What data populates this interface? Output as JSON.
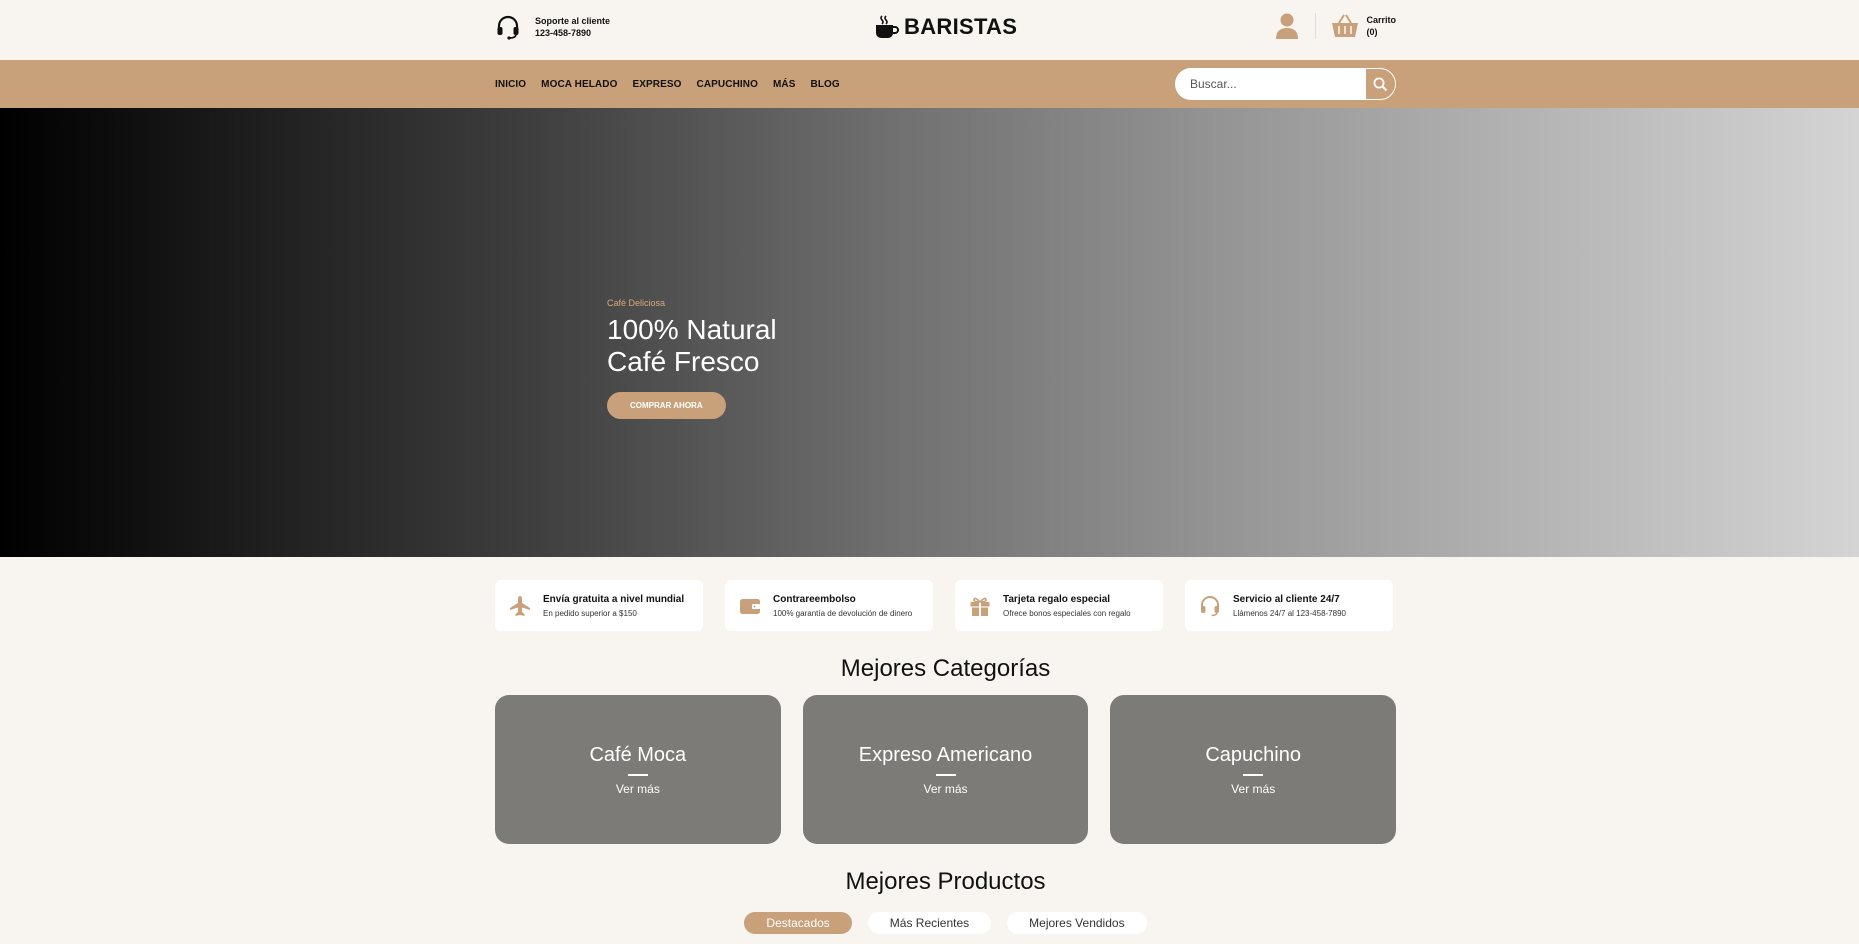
{
  "header": {
    "support_label": "Soporte al cliente",
    "support_phone": "123-458-7890",
    "brand": "BARISTAS",
    "cart_label": "Carrito",
    "cart_count": "(0)"
  },
  "nav": {
    "items": [
      "INICIO",
      "MOCA HELADO",
      "EXPRESO",
      "CAPUCHINO",
      "MÁS",
      "BLOG"
    ],
    "search_placeholder": "Buscar..."
  },
  "hero": {
    "kicker": "Café Deliciosa",
    "title_line1": "100% Natural",
    "title_line2": "Café Fresco",
    "cta": "COMPRAR AHORA"
  },
  "features": [
    {
      "title": "Envía gratuita a nivel mundial",
      "desc": "En pedido superior a $150",
      "icon": "plane-icon"
    },
    {
      "title": "Contrareembolso",
      "desc": "100% garantía de devolución de dinero",
      "icon": "wallet-icon"
    },
    {
      "title": "Tarjeta regalo especial",
      "desc": "Ofrece bonos especiales con regalo",
      "icon": "gift-icon"
    },
    {
      "title": "Servicio al cliente 24/7",
      "desc": "Llámenos 24/7 al 123-458-7890",
      "icon": "headset-icon"
    }
  ],
  "categories": {
    "title": "Mejores Categorías",
    "items": [
      {
        "name": "Café Moca",
        "more": "Ver más"
      },
      {
        "name": "Expreso Americano",
        "more": "Ver más"
      },
      {
        "name": "Capuchino",
        "more": "Ver más"
      }
    ]
  },
  "products": {
    "title": "Mejores Productos",
    "tabs": [
      "Destacados",
      "Más Recientes",
      "Mejores Vendidos"
    ]
  },
  "colors": {
    "accent": "#c8a07a",
    "background": "#f8f5f0",
    "category_card": "#7c7b78"
  }
}
